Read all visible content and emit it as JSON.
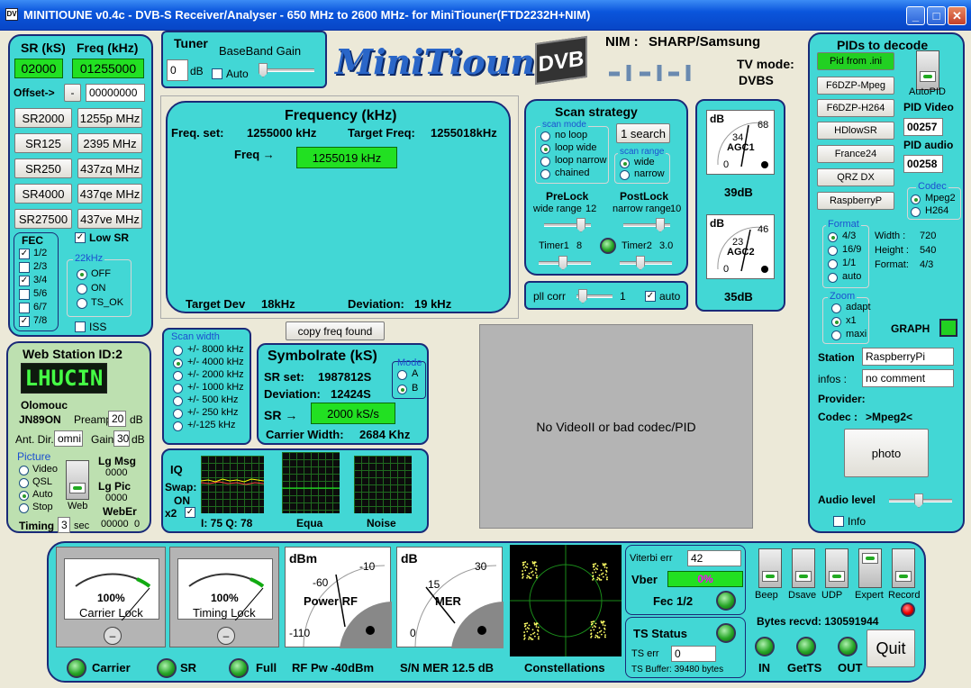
{
  "window": {
    "title": "MINITIOUNE v0.4c - DVB-S Receiver/Analyser - 650 MHz to 2600 MHz- for MiniTiouner(FTD2232H+NIM)"
  },
  "left": {
    "sr_header": "SR (kS)",
    "freq_header": "Freq (kHz)",
    "sr_value": "02000",
    "freq_value": "01255000",
    "offset_label": "Offset->",
    "offset_sign": "-",
    "offset_value": "00000000",
    "sr_buttons": [
      "SR2000",
      "SR125",
      "SR250",
      "SR4000",
      "SR27500"
    ],
    "freq_buttons": [
      "1255p MHz",
      "2395 MHz",
      "437zq MHz",
      "437qe MHz",
      "437ve MHz"
    ],
    "fec_title": "FEC",
    "fec": [
      {
        "label": "1/2",
        "on": true
      },
      {
        "label": "2/3",
        "on": false
      },
      {
        "label": "3/4",
        "on": true
      },
      {
        "label": "5/6",
        "on": false
      },
      {
        "label": "6/7",
        "on": false
      },
      {
        "label": "7/8",
        "on": true
      }
    ],
    "low_sr": "Low SR",
    "khz_title": "22kHz",
    "khz": [
      "OFF",
      "ON",
      "TS_OK"
    ],
    "iss": "ISS"
  },
  "web": {
    "title": "Web Station ID:2",
    "callsign": "LHUCIN",
    "city": "Olomouc",
    "locator": "JN89ON",
    "preamp_label": "Preamp",
    "preamp": "20",
    "db": "dB",
    "ant_label": "Ant. Dir.",
    "ant": "omni",
    "gain_label": "Gain",
    "gain": "30",
    "picture_title": "Picture",
    "picture": [
      "Video",
      "QSL",
      "Auto",
      "Stop"
    ],
    "web_label": "Web",
    "lgmsg_label": "Lg Msg",
    "lgmsg": "0000",
    "lgpic_label": "Lg Pic",
    "lgpic": "0000",
    "weber_label": "WebEr",
    "weber": "00000",
    "weber2": "0",
    "timing_label": "Timing",
    "timing": "3",
    "sec": "sec"
  },
  "tuner": {
    "title": "Tuner",
    "bb_label": "BaseBand Gain",
    "value": "0",
    "unit": "dB",
    "auto": "Auto"
  },
  "logo": {
    "text": "MiniTioune",
    "badge": "DVB"
  },
  "nim": {
    "label": "NIM :",
    "value": "SHARP/Samsung",
    "tv_label": "TV mode:",
    "tv_value": "DVBS"
  },
  "freq": {
    "title": "Frequency (kHz)",
    "set_label": "Freq. set:",
    "set": "1255000 kHz",
    "target_label": "Target Freq:",
    "target": "1255018kHz",
    "freq_label": "Freq →",
    "freq": "1255019 kHz",
    "tdev_label": "Target Dev",
    "tdev": "18kHz",
    "dev_label": "Deviation:",
    "dev": "19 kHz"
  },
  "scan": {
    "title": "Scan strategy",
    "mode_title": "scan mode",
    "modes": [
      "no loop",
      "loop wide",
      "loop narrow",
      "chained"
    ],
    "search_btn": "1 search",
    "range_title": "scan range",
    "ranges": [
      "wide",
      "narrow"
    ],
    "prelock": "PreLock",
    "prelock_sub": "wide range",
    "prelock_val": "12",
    "postlock": "PostLock",
    "postlock_sub": "narrow range",
    "postlock_val": "10",
    "timer1": "Timer1",
    "timer1_val": "8",
    "timer2": "Timer2",
    "timer2_val": "3.0",
    "pll": "pll corr",
    "pll_val": "1",
    "pll_auto": "auto"
  },
  "agc": {
    "agc1_title": "AGC1",
    "agc1_db": "39dB",
    "agc1_top": "68",
    "agc1_mid": "34",
    "agc1_low": "0",
    "agc2_title": "AGC2",
    "agc2_db": "35dB",
    "agc2_top": "46",
    "agc2_mid": "23",
    "agc2_low": "0",
    "unit": "dB"
  },
  "pids": {
    "title": "PIDs to decode",
    "buttons": [
      "Pid from .ini",
      "F6DZP-Mpeg",
      "F6DZP-H264",
      "HDlowSR",
      "France24",
      "QRZ DX",
      "RaspberryP"
    ],
    "autopid": "AutoPID",
    "video_label": "PID Video",
    "video": "00257",
    "audio_label": "PID audio",
    "audio": "00258",
    "codec_title": "Codec",
    "codecs": [
      "Mpeg2",
      "H264"
    ],
    "format_title": "Format",
    "formats": [
      "4/3",
      "16/9",
      "1/1",
      "auto"
    ],
    "width_label": "Width :",
    "width": "720",
    "height_label": "Height :",
    "height": "540",
    "format_label": "Format:",
    "format": "4/3",
    "zoom_title": "Zoom",
    "zooms": [
      "adapt",
      "x1",
      "maxi"
    ],
    "graph": "GRAPH",
    "station_label": "Station",
    "station": "RaspberryPi",
    "infos_label": "infos :",
    "infos": "no comment",
    "provider_label": "Provider:",
    "codec_label": "Codec :",
    "codec": ">Mpeg2<",
    "photo": "photo",
    "audio_level": "Audio level",
    "info": "Info"
  },
  "copy_btn": "copy freq found",
  "scanw": {
    "title": "Scan width",
    "items": [
      "+/- 8000 kHz",
      "+/- 4000 kHz",
      "+/- 2000 kHz",
      "+/- 1000 kHz",
      "+/- 500 kHz",
      "+/- 250 kHz",
      "+/-125 kHz"
    ]
  },
  "symbol": {
    "title": "Symbolrate (kS)",
    "set_label": "SR set:",
    "set": "1987812S",
    "dev_label": "Deviation:",
    "dev": "12424S",
    "sr_label": "SR →",
    "sr": "2000 kS/s",
    "cw_label": "Carrier Width:",
    "cw": "2684 Khz",
    "mode_title": "Mode",
    "modes": [
      "A",
      "B"
    ]
  },
  "video": {
    "msg": "No VideoII or bad codec/PID"
  },
  "iq": {
    "title": "IQ",
    "swap": "Swap:",
    "swap_val": "ON",
    "x2": "x2",
    "iq_vals": "I: 75 Q: 78",
    "equa": "Equa",
    "noise": "Noise"
  },
  "bottom": {
    "carrier_pct": "100%",
    "carrier_lbl": "Carrier Lock",
    "timing_pct": "100%",
    "timing_lbl": "Timing Lock",
    "power_unit": "dBm",
    "power_title": "Power RF",
    "power_top": "-10",
    "power_mid": "-60",
    "power_low": "-110",
    "mer_unit": "dB",
    "mer_title": "MER",
    "mer_top": "30",
    "mer_mid": "15",
    "mer_low": "0",
    "viterbi_label": "Viterbi err",
    "viterbi": "42",
    "vber_label": "Vber",
    "vber": "0%",
    "fec_label": "Fec 1/2",
    "ts_title": "TS Status",
    "ts_err_label": "TS err",
    "ts_err": "0",
    "ts_buffer": "TS Buffer: 39480 bytes",
    "toggles": [
      "Beep",
      "Dsave",
      "UDP",
      "Expert",
      "Record"
    ],
    "bytes": "Bytes recvd:  130591944",
    "quit": "Quit",
    "in": "IN",
    "getts": "GetTS",
    "out": "OUT",
    "carrier": "Carrier",
    "sr": "SR",
    "full": "Full",
    "rfpw": "RF Pw -40dBm",
    "mer": "S/N MER  12.5 dB",
    "const": "Constellations"
  }
}
